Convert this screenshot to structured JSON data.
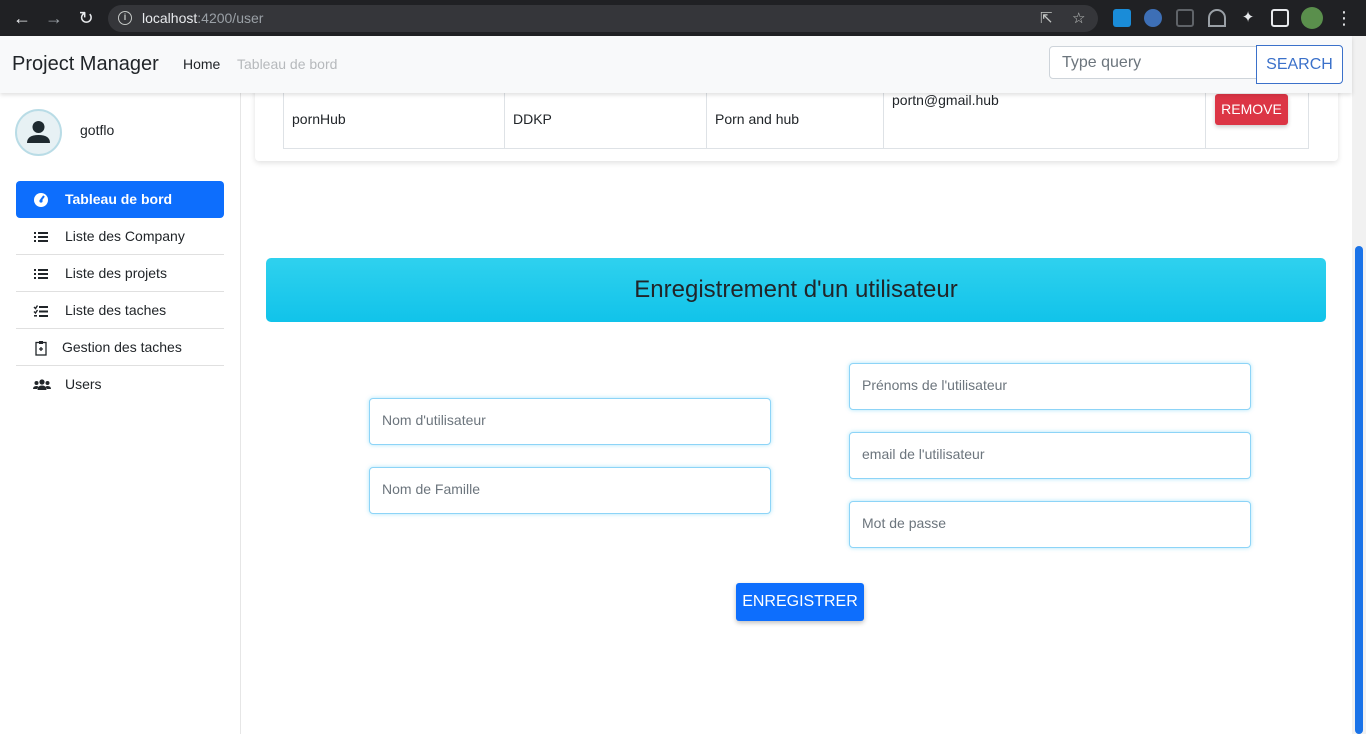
{
  "browser": {
    "url_host": "localhost",
    "url_rest": ":4200/user"
  },
  "navbar": {
    "brand": "Project Manager",
    "links": [
      "Home",
      "Tableau de bord"
    ],
    "search_placeholder": "Type query",
    "search_button": "SEARCH"
  },
  "sidebar": {
    "user_name": "gotflo",
    "items": [
      {
        "label": "Tableau de bord",
        "icon": "dashboard-icon",
        "active": true
      },
      {
        "label": "Liste des Company",
        "icon": "list-icon",
        "active": false
      },
      {
        "label": "Liste des projets",
        "icon": "list-icon",
        "active": false
      },
      {
        "label": "Liste des taches",
        "icon": "list-check-icon",
        "active": false
      },
      {
        "label": "Gestion des taches",
        "icon": "clipboard-icon",
        "active": false
      },
      {
        "label": "Users",
        "icon": "users-icon",
        "active": false
      }
    ]
  },
  "table": {
    "row": {
      "name": "pornHub",
      "code": "DDKP",
      "description": "Porn and hub",
      "email": "portn@gmail.hub",
      "action": "REMOVE"
    }
  },
  "form": {
    "title": "Enregistrement d'un utilisateur",
    "username_placeholder": "Nom d'utilisateur",
    "lastname_placeholder": "Nom de Famille",
    "firstname_placeholder": "Prénoms de l'utilisateur",
    "email_placeholder": "email de l'utilisateur",
    "password_placeholder": "Mot de passe",
    "submit": "ENREGISTRER"
  },
  "colors": {
    "primary": "#0d6efd",
    "danger": "#dc3545",
    "banner": "#11c3ea"
  }
}
